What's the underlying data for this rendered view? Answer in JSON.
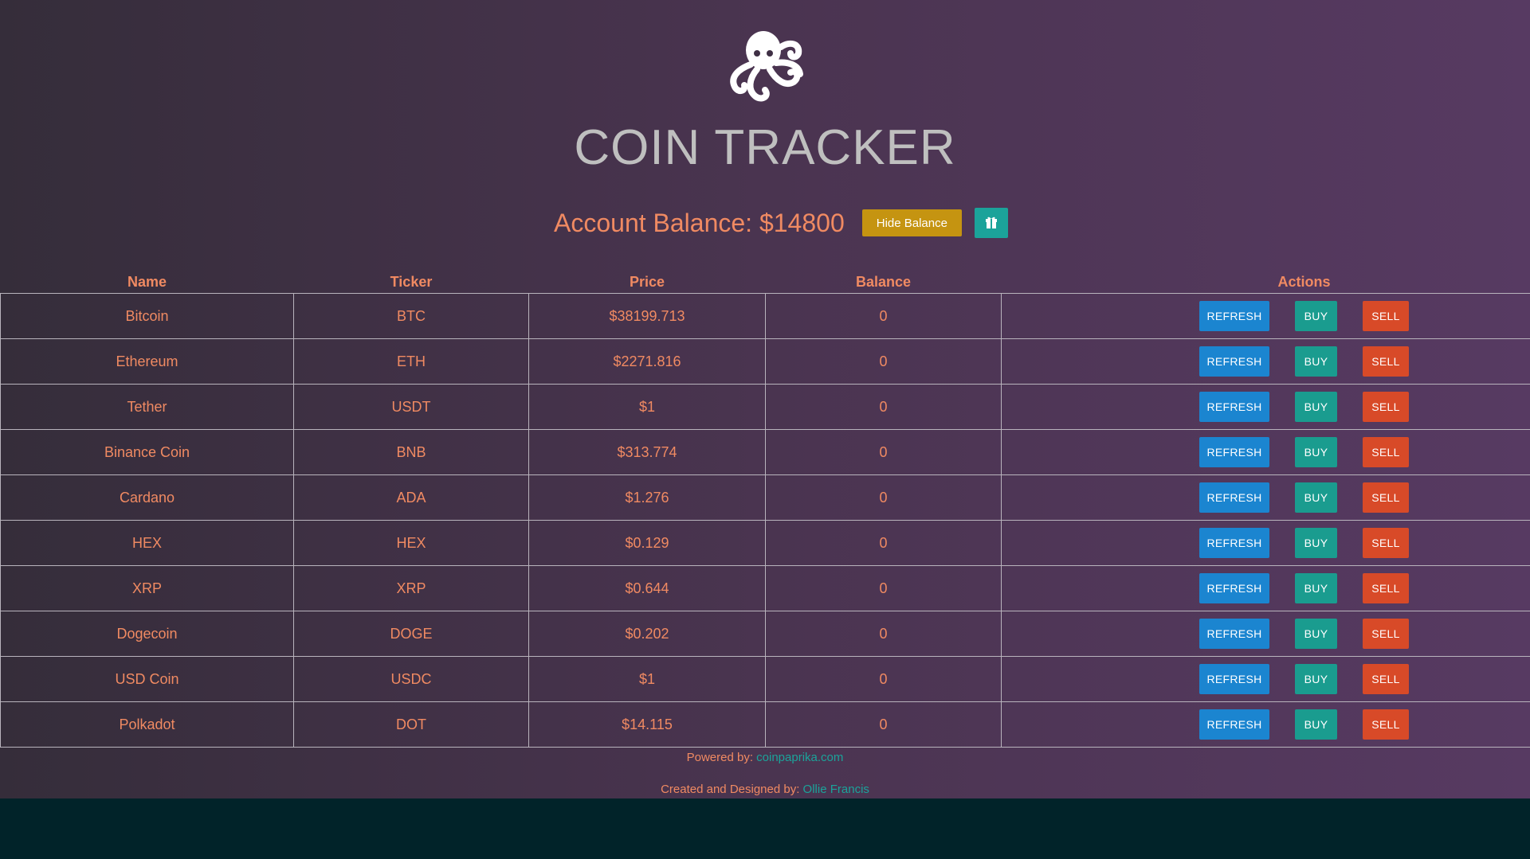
{
  "header": {
    "logo_icon": "octopus-icon",
    "title": "COIN TRACKER"
  },
  "account": {
    "balance_label": "Account Balance: $14800",
    "hide_button": "Hide Balance",
    "extra_button_icon": "gift-icon"
  },
  "table": {
    "columns": [
      "Name",
      "Ticker",
      "Price",
      "Balance",
      "Actions"
    ],
    "rows": [
      {
        "name": "Bitcoin",
        "ticker": "BTC",
        "price": "$38199.713",
        "balance": "0"
      },
      {
        "name": "Ethereum",
        "ticker": "ETH",
        "price": "$2271.816",
        "balance": "0"
      },
      {
        "name": "Tether",
        "ticker": "USDT",
        "price": "$1",
        "balance": "0"
      },
      {
        "name": "Binance Coin",
        "ticker": "BNB",
        "price": "$313.774",
        "balance": "0"
      },
      {
        "name": "Cardano",
        "ticker": "ADA",
        "price": "$1.276",
        "balance": "0"
      },
      {
        "name": "HEX",
        "ticker": "HEX",
        "price": "$0.129",
        "balance": "0"
      },
      {
        "name": "XRP",
        "ticker": "XRP",
        "price": "$0.644",
        "balance": "0"
      },
      {
        "name": "Dogecoin",
        "ticker": "DOGE",
        "price": "$0.202",
        "balance": "0"
      },
      {
        "name": "USD Coin",
        "ticker": "USDC",
        "price": "$1",
        "balance": "0"
      },
      {
        "name": "Polkadot",
        "ticker": "DOT",
        "price": "$14.115",
        "balance": "0"
      }
    ],
    "actions": {
      "refresh": "REFRESH",
      "buy": "BUY",
      "sell": "SELL"
    }
  },
  "footer": {
    "powered_label": "Powered by: ",
    "powered_link": "coinpaprika.com",
    "created_label": "Created and Designed by: ",
    "created_link": "Ollie Francis"
  },
  "colors": {
    "accent_text": "#f08a62",
    "hide_button": "#c59411",
    "teal": "#1ba39a",
    "refresh": "#1b85d0",
    "buy": "#1a9c8f",
    "sell": "#d84a28"
  }
}
